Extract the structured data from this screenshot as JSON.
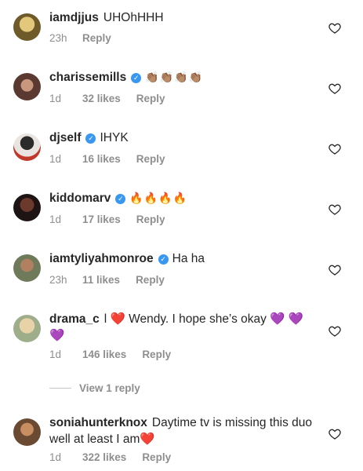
{
  "comments": [
    {
      "user": "iamdjjus",
      "verified": false,
      "text": "UHOhHHH",
      "time": "23h",
      "likes": "",
      "reply": "Reply",
      "avatar_color": "#b59a5b"
    },
    {
      "user": "charissemills",
      "verified": true,
      "text": "👏🏽👏🏽👏🏽👏🏽",
      "time": "1d",
      "likes": "32 likes",
      "reply": "Reply",
      "avatar_color": "#9b6d5a"
    },
    {
      "user": "djself",
      "verified": true,
      "text": "IHYK",
      "time": "1d",
      "likes": "16 likes",
      "reply": "Reply",
      "avatar_color": "#3a3a3a"
    },
    {
      "user": "kiddomarv",
      "verified": true,
      "text": "🔥🔥🔥🔥",
      "time": "1d",
      "likes": "17 likes",
      "reply": "Reply",
      "avatar_color": "#4a2d2d"
    },
    {
      "user": "iamtyliyahmonroe",
      "verified": true,
      "text": "Ha ha",
      "time": "23h",
      "likes": "11 likes",
      "reply": "Reply",
      "avatar_color": "#7a8a6a"
    },
    {
      "user": "drama_c",
      "verified": false,
      "text": "l ❤️ Wendy. I hope she’s okay 💜 💜💜",
      "time": "1d",
      "likes": "146 likes",
      "reply": "Reply",
      "avatar_color": "#d6c29a"
    },
    {
      "user": "soniahunterknox",
      "verified": false,
      "text": "Daytime tv is missing this duo well at least I am❤️",
      "time": "1d",
      "likes": "322 likes",
      "reply": "Reply",
      "avatar_color": "#a77a5a"
    }
  ],
  "view_replies": "View 1 reply",
  "verified_mark": "✓"
}
